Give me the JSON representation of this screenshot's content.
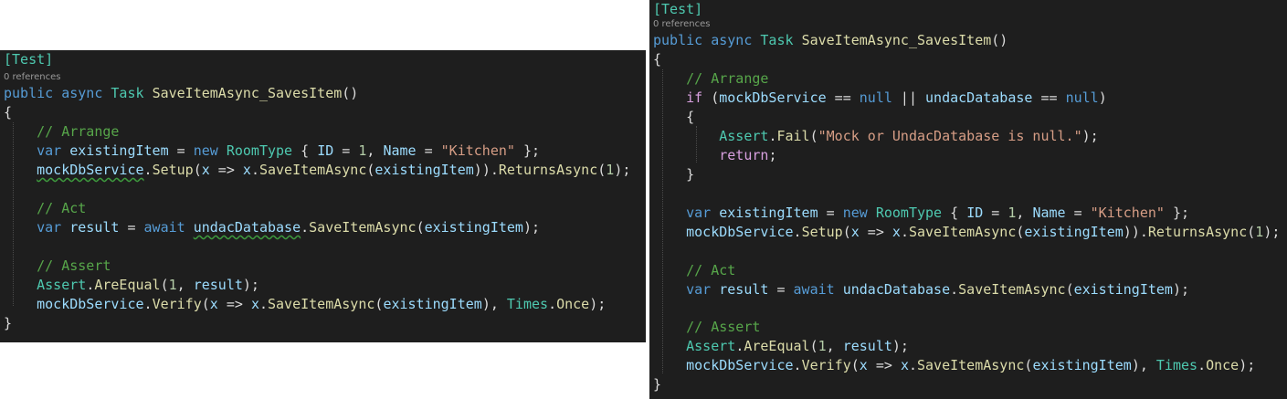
{
  "left": {
    "attribute": "[Test]",
    "references": "0 references",
    "kw_public": "public",
    "kw_async": "async",
    "type_task": "Task",
    "method_name": "SaveItemAsync_SavesItem",
    "sig_parens": "()",
    "brace_open": "{",
    "brace_close": "}",
    "comment_arrange": "// Arrange",
    "comment_act": "// Act",
    "comment_assert": "// Assert",
    "kw_var": "var",
    "var_existing": "existingItem",
    "op_assign": " = ",
    "kw_new": "new",
    "type_roomtype": "RoomType",
    "init_open": " { ",
    "prop_id": "ID",
    "num_1": "1",
    "comma_sp": ", ",
    "prop_name": "Name",
    "str_kitchen": "\"Kitchen\"",
    "init_close": " };",
    "var_mock": "mockDbService",
    "dot": ".",
    "m_setup": "Setup",
    "paren_open": "(",
    "paren_close": ")",
    "var_x": "x",
    "arrow": " => ",
    "m_saveitem": "SaveItemAsync",
    "m_returns": "ReturnsAsync",
    "semi_close": ");",
    "var_result": "result",
    "kw_await": "await",
    "var_undac": "undacDatabase",
    "type_assert": "Assert",
    "m_areequal": "AreEqual",
    "m_verify": "Verify",
    "type_times": "Times",
    "m_once": "Once"
  },
  "right": {
    "attribute": "[Test]",
    "references": "0 references",
    "kw_public": "public",
    "kw_async": "async",
    "type_task": "Task",
    "method_name": "SaveItemAsync_SavesItem",
    "sig_parens": "()",
    "brace_open": "{",
    "brace_close": "}",
    "comment_arrange": "// Arrange",
    "comment_act": "// Act",
    "comment_assert": "// Assert",
    "kw_if": "if",
    "if_open": " (",
    "op_eq": " == ",
    "kw_null": "null",
    "op_or": " || ",
    "if_close": ")",
    "m_fail": "Fail",
    "str_fail": "\"Mock or UndacDatabase is null.\"",
    "kw_return": "return",
    "semi": ";",
    "kw_var": "var",
    "var_existing": "existingItem",
    "op_assign": " = ",
    "kw_new": "new",
    "type_roomtype": "RoomType",
    "init_open": " { ",
    "prop_id": "ID",
    "num_1": "1",
    "comma_sp": ", ",
    "prop_name": "Name",
    "str_kitchen": "\"Kitchen\"",
    "init_close": " };",
    "var_mock": "mockDbService",
    "dot": ".",
    "m_setup": "Setup",
    "paren_open": "(",
    "paren_close": ")",
    "var_x": "x",
    "arrow": " => ",
    "m_saveitem": "SaveItemAsync",
    "m_returns": "ReturnsAsync",
    "semi_close": ");",
    "var_result": "result",
    "kw_await": "await",
    "var_undac": "undacDatabase",
    "type_assert": "Assert",
    "m_areequal": "AreEqual",
    "m_verify": "Verify",
    "type_times": "Times",
    "m_once": "Once"
  },
  "colors": {
    "editor_background": "#1e1e1e",
    "keyword": "#569cd6",
    "control_keyword": "#d8a0df",
    "type": "#4ec9b0",
    "method": "#dcdcaa",
    "variable": "#9cdcfe",
    "string": "#d69d85",
    "number": "#b5cea8",
    "comment": "#57a64a",
    "default_text": "#dcdcdc"
  }
}
